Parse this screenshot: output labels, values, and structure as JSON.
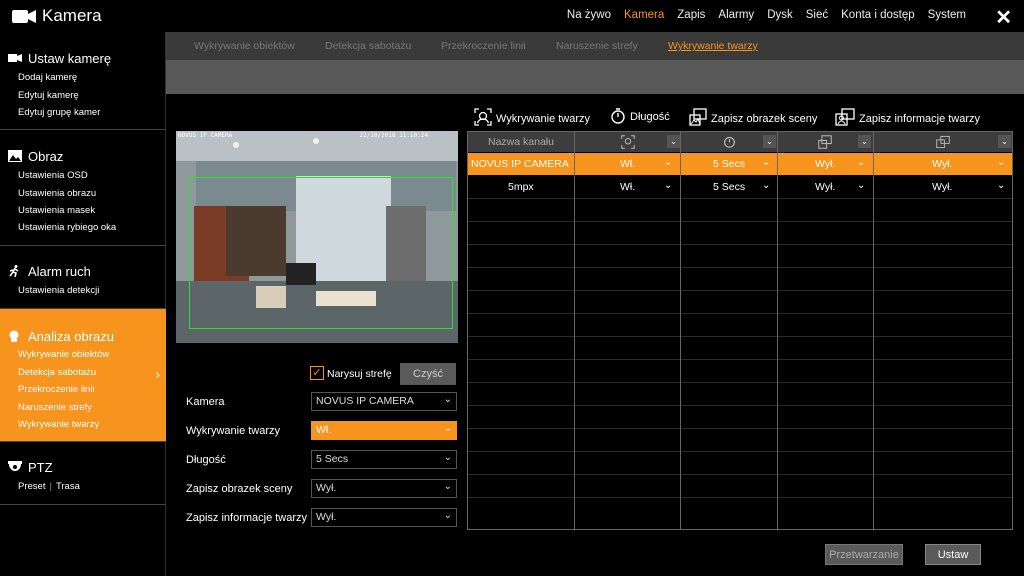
{
  "app": {
    "title": "Kamera"
  },
  "topnav": [
    "Na żywo",
    "Kamera",
    "Zapis",
    "Alarmy",
    "Dysk",
    "Sieć",
    "Konta i dostęp",
    "System"
  ],
  "topnav_active": "Kamera",
  "sidebar": {
    "ustaw": {
      "title": "Ustaw kamerę",
      "items": [
        "Dodaj kamerę",
        "Edytuj kamerę",
        "Edytuj grupę kamer"
      ]
    },
    "obraz": {
      "title": "Obraz",
      "items": [
        "Ustawienia OSD",
        "Ustawienia obrazu",
        "Ustawienia masek",
        "Ustawienia rybiego oka"
      ]
    },
    "alarm": {
      "title": "Alarm ruch",
      "items": [
        "Ustawienia detekcji"
      ]
    },
    "analiza": {
      "title": "Analiza obrazu",
      "items": [
        "Wykrywanie obiektów",
        "Detekcja sabotażu",
        "Przekroczenie linii",
        "Naruszenie strefy",
        "Wykrywanie twarzy"
      ]
    },
    "ptz": {
      "title": "PTZ",
      "items": [
        "Preset",
        "Trasa"
      ]
    }
  },
  "subtabs": [
    "Wykrywanie obiektów",
    "Detekcja sabotażu",
    "Przekroczenie linii",
    "Naruszenie strefy",
    "Wykrywanie twarzy"
  ],
  "subtab_active": "Wykrywanie twarzy",
  "preview": {
    "osd_name": "NOVUS IP CAMERA",
    "osd_time": "22/10/2018 11:10:24"
  },
  "form": {
    "draw_zone": "Narysuj strefę",
    "clear": "Czyść",
    "camera_label": "Kamera",
    "camera_value": "NOVUS IP CAMERA",
    "face_label": "Wykrywanie twarzy",
    "face_value": "Wł.",
    "length_label": "Długość",
    "length_value": "5 Secs",
    "scene_label": "Zapisz obrazek sceny",
    "scene_value": "Wył.",
    "info_label": "Zapisz informacje twarzy",
    "info_value": "Wył."
  },
  "columns": {
    "face": "Wykrywanie twarzy",
    "length": "Długość",
    "scene": "Zapisz obrazek sceny",
    "info": "Zapisz informacje twarzy"
  },
  "table": {
    "header_name": "Nazwa kanału",
    "rows": [
      {
        "name": "NOVUS IP CAMERA",
        "face": "Wł.",
        "length": "5 Secs",
        "scene": "Wył.",
        "info": "Wył."
      },
      {
        "name": "5mpx",
        "face": "Wł.",
        "length": "5 Secs",
        "scene": "Wył.",
        "info": "Wył."
      }
    ]
  },
  "buttons": {
    "process": "Przetwarzanie",
    "set": "Ustaw"
  },
  "colors": {
    "accent": "#f7941d",
    "grid_line": "#666666"
  }
}
